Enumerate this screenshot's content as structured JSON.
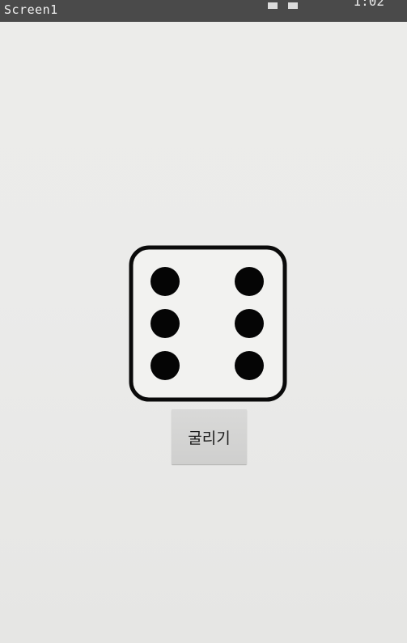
{
  "app": {
    "title": "Screen1",
    "clock": "1:02"
  },
  "dice": {
    "face_value": 6
  },
  "roll_button": {
    "label": "굴리기"
  }
}
